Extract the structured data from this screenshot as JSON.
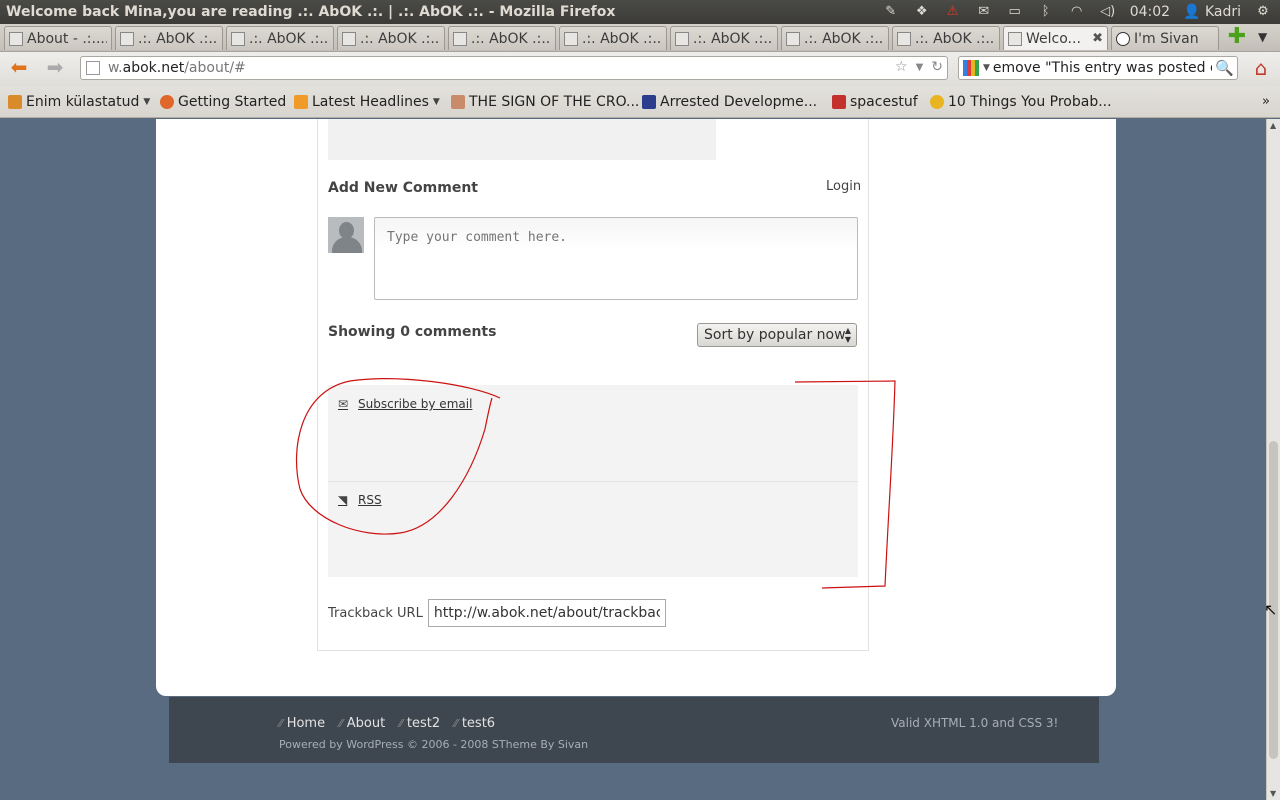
{
  "window": {
    "title": "Welcome back Mina,you are reading .:. AbOK .:. | .:. AbOK .:. - Mozilla Firefox",
    "tray": {
      "time": "04:02",
      "user": "Kadri"
    }
  },
  "tabs": [
    {
      "label": "About - .:...."
    },
    {
      "label": ".:. AbOK .:..."
    },
    {
      "label": ".:. AbOK .:..."
    },
    {
      "label": ".:. AbOK .:..."
    },
    {
      "label": ".:. AbOK .:..."
    },
    {
      "label": ".:. AbOK .:..."
    },
    {
      "label": ".:. AbOK .:..."
    },
    {
      "label": ".:. AbOK .:..."
    },
    {
      "label": ".:. AbOK .:..."
    },
    {
      "label": "Welco..."
    },
    {
      "label": "I'm Sivan"
    }
  ],
  "navbar": {
    "url_pre": "w.",
    "url_domain": "abok.net",
    "url_post": "/about/#",
    "search_text": "emove \"This entry was posted on\""
  },
  "bookmarks": [
    {
      "label": "Enim külastatud",
      "color": "#d98a2b"
    },
    {
      "label": "Getting Started",
      "color": "#e0662a"
    },
    {
      "label": "Latest Headlines",
      "color": "#f09a2a"
    },
    {
      "label": "THE SIGN OF THE CRO...",
      "color": "#c98c6a"
    },
    {
      "label": "Arrested Developme...",
      "color": "#2b3d8c"
    },
    {
      "label": "spacestuf",
      "color": "#c4302b"
    },
    {
      "label": "10 Things You Probab...",
      "color": "#e8b422"
    }
  ],
  "comments": {
    "add_heading": "Add New Comment",
    "login": "Login",
    "placeholder": "Type your comment here.",
    "showing": "Showing 0 comments",
    "sort_label": "Sort by popular now",
    "subscribe_email": "Subscribe by email",
    "rss": "RSS",
    "trackback_label": "Trackback URL",
    "trackback_value": "http://w.abok.net/about/trackback/"
  },
  "footer": {
    "nav": [
      "Home",
      "About",
      "test2",
      "test6"
    ],
    "powered": "Powered by WordPress © 2006 - 2008 STheme By Sivan",
    "valid": "Valid XHTML 1.0 and CSS 3!"
  },
  "colors": {
    "annotation": "#cc1111",
    "page_bg": "#586b80",
    "footer_bg": "#3e4650"
  }
}
